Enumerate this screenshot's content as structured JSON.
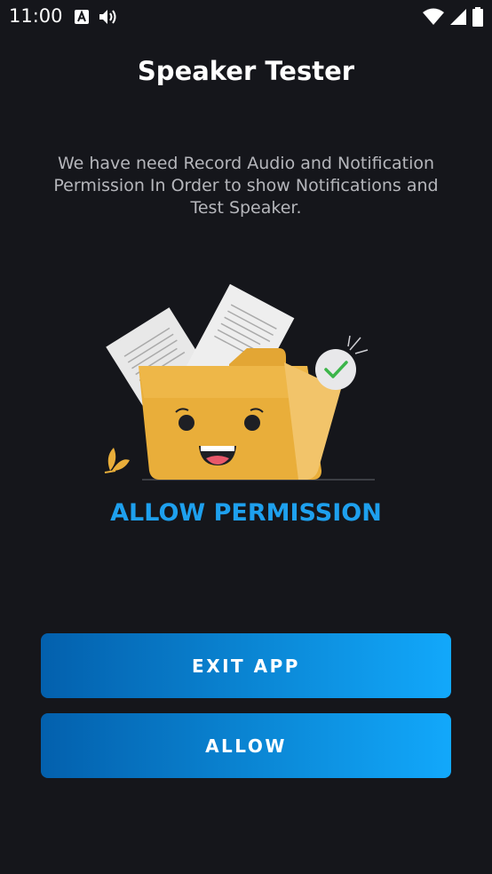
{
  "status_bar": {
    "time": "11:00",
    "left_icons": [
      "font-a-icon",
      "volume-icon"
    ],
    "right_icons": [
      "wifi-icon",
      "cell-signal-icon",
      "battery-icon"
    ]
  },
  "app": {
    "title": "Speaker Tester"
  },
  "content": {
    "description": "We have need Record Audio and Notification Permission In Order to show Notifications and Test Speaker.",
    "illustration": "folder-with-documents-illustration",
    "heading": "ALLOW PERMISSION"
  },
  "buttons": {
    "exit_label": "EXIT APP",
    "allow_label": "ALLOW"
  },
  "colors": {
    "background": "#15161b",
    "accent": "#1ea0ee",
    "button_gradient_start": "#0360ad",
    "button_gradient_end": "#12a8fb",
    "folder": "#e9ae3a",
    "check": "#3cb54a"
  }
}
